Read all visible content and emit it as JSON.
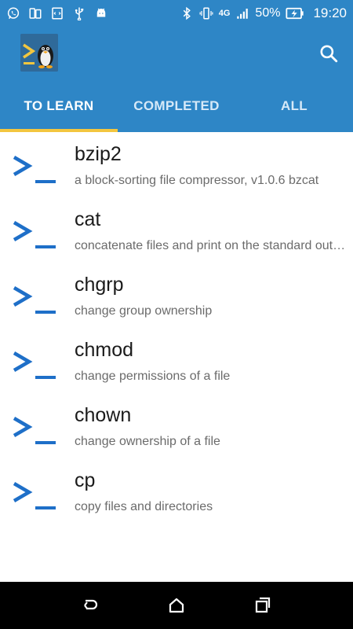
{
  "status_bar": {
    "battery_percent": "50%",
    "time": "19:20",
    "network": "4G",
    "left_icons": [
      "whatsapp-icon",
      "tablet-icon",
      "code-icon",
      "usb-icon",
      "android-icon"
    ],
    "right_icons": [
      "bluetooth-icon",
      "vibrate-icon",
      "signal-icon",
      "battery-charging-icon"
    ]
  },
  "app_bar": {
    "logo": "linux-terminal-penguin-logo",
    "search_icon": "search-icon"
  },
  "tabs": [
    {
      "label": "TO LEARN",
      "active": true
    },
    {
      "label": "COMPLETED",
      "active": false
    },
    {
      "label": "ALL",
      "active": false
    }
  ],
  "commands": [
    {
      "name": "bzip2",
      "description": "a block-sorting file compressor, v1.0.6  bzcat"
    },
    {
      "name": "cat",
      "description": "concatenate files and print on the standard output"
    },
    {
      "name": "chgrp",
      "description": "change group ownership"
    },
    {
      "name": "chmod",
      "description": "change permissions of a file"
    },
    {
      "name": "chown",
      "description": "change ownership of a file"
    },
    {
      "name": "cp",
      "description": "copy files and directories"
    }
  ],
  "nav_bar": {
    "back_icon": "back-icon",
    "home_icon": "home-icon",
    "recents_icon": "recents-icon"
  },
  "colors": {
    "primary": "#2e86c6",
    "tab_indicator": "#f3c63f",
    "icon_blue": "#1e6fc8"
  }
}
